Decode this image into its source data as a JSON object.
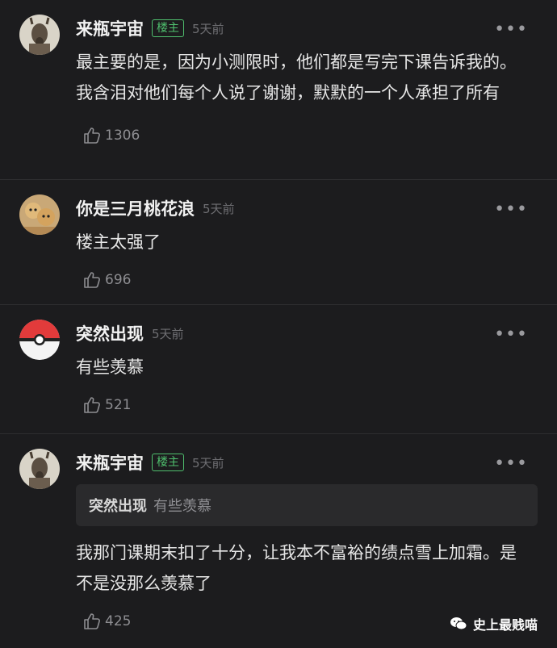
{
  "comments": [
    {
      "username": "来瓶宇宙",
      "badge": "楼主",
      "time": "5天前",
      "more": "•••",
      "avatar_icon": "goat-avatar",
      "text": "最主要的是，因为小测限时，他们都是写完下课告诉我的。我含泪对他们每个人说了谢谢，默默的一个人承担了所有",
      "likes": "1306"
    },
    {
      "username": "你是三月桃花浪",
      "time": "5天前",
      "more": "•••",
      "avatar_icon": "cats-avatar",
      "text": "楼主太强了",
      "likes": "696"
    },
    {
      "username": "突然出现",
      "time": "5天前",
      "more": "•••",
      "avatar_icon": "pokeball-avatar",
      "text": "有些羡慕",
      "likes": "521"
    },
    {
      "username": "来瓶宇宙",
      "badge": "楼主",
      "time": "5天前",
      "more": "•••",
      "avatar_icon": "goat-avatar",
      "quote_user": "突然出现",
      "quote_text": "有些羡慕",
      "text": "我那门课期末扣了十分，让我本不富裕的绩点雪上加霜。是不是没那么羡慕了",
      "likes": "425"
    }
  ],
  "watermark": {
    "label": "史上最贱喵",
    "icon": "wechat-icon"
  },
  "colors": {
    "background": "#1c1c1e",
    "badge": "#4fbf6e",
    "muted": "#8e8e92"
  }
}
